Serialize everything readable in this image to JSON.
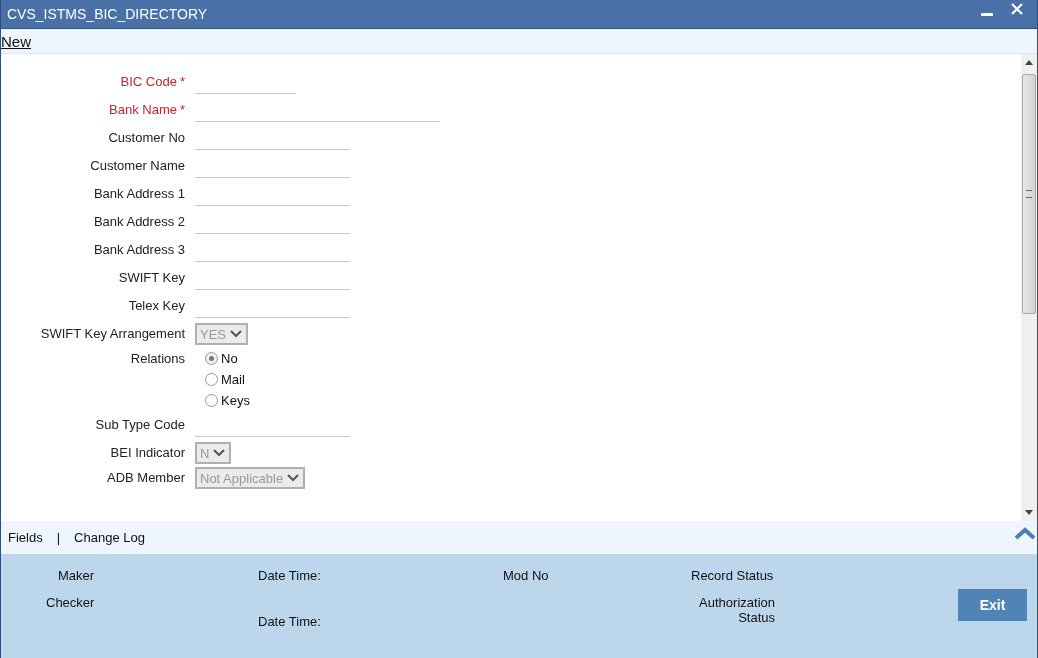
{
  "window": {
    "title": "CVS_ISTMS_BIC_DIRECTORY"
  },
  "toolbar": {
    "new_link": "New"
  },
  "fields": [
    {
      "kind": "text",
      "label": "BIC Code",
      "required": true,
      "mark": "*"
    },
    {
      "kind": "text",
      "label": "Bank Name",
      "required": true,
      "mark": "*"
    },
    {
      "kind": "text",
      "label": "Customer No",
      "required": false
    },
    {
      "kind": "text",
      "label": "Customer Name",
      "required": false
    },
    {
      "kind": "text",
      "label": "Bank Address 1",
      "required": false
    },
    {
      "kind": "text",
      "label": "Bank Address 2",
      "required": false
    },
    {
      "kind": "text",
      "label": "Bank Address 3",
      "required": false
    },
    {
      "kind": "text",
      "label": "SWIFT Key",
      "required": false
    },
    {
      "kind": "text",
      "label": "Telex Key",
      "required": false
    },
    {
      "kind": "select",
      "label": "SWIFT Key Arrangement",
      "value": "YES",
      "disabled": true
    },
    {
      "kind": "radio",
      "label": "Relations",
      "options": [
        {
          "label": "No",
          "selected": true
        },
        {
          "label": "Mail",
          "selected": false
        },
        {
          "label": "Keys",
          "selected": false
        }
      ]
    },
    {
      "kind": "text",
      "label": "Sub Type Code",
      "required": false
    },
    {
      "kind": "select",
      "label": "BEI Indicator",
      "value": "N",
      "disabled": true
    },
    {
      "kind": "select",
      "label": "ADB Member",
      "value": "Not Applicable",
      "disabled": true
    }
  ],
  "bottom_tabs": {
    "items": [
      "Fields",
      "Change Log"
    ],
    "separator": "|"
  },
  "audit": {
    "maker": "Maker",
    "maker_date_time": "Date Time:",
    "mod_no": "Mod No",
    "record_status": "Record Status",
    "checker": "Checker",
    "checker_date_time": "Date Time:",
    "authorization_status": "Authorization Status"
  },
  "buttons": {
    "exit": "Exit"
  }
}
